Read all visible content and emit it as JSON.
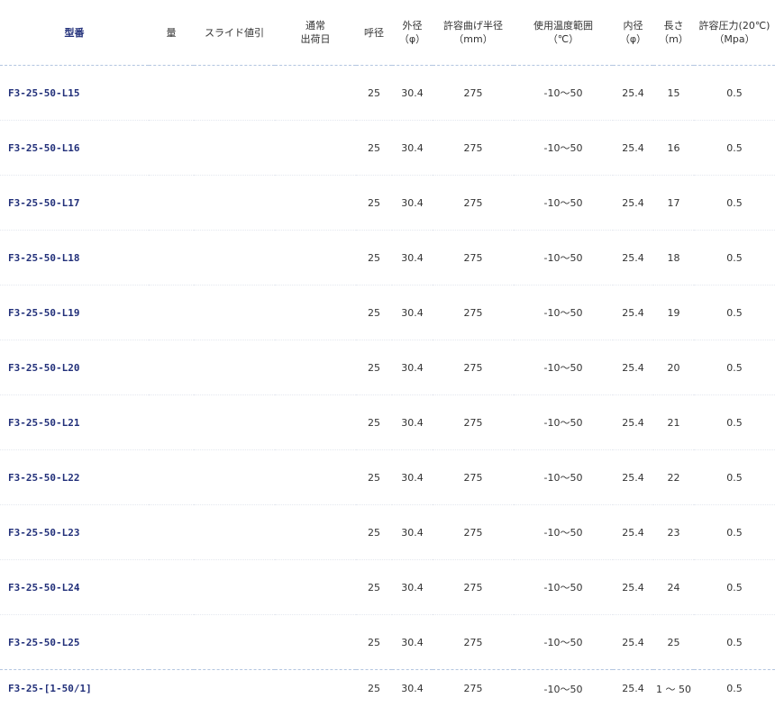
{
  "table": {
    "headers": {
      "model": "型番",
      "qty": "量",
      "discount": "スライド値引",
      "shipping_l1": "通常",
      "shipping_l2": "出荷日",
      "nominal": "呼径",
      "outer_l1": "外径",
      "outer_l2": "（φ）",
      "bend_l1": "許容曲げ半径",
      "bend_l2": "（mm）",
      "temp_l1": "使用温度範囲",
      "temp_l2": "（℃）",
      "inner_l1": "内径",
      "inner_l2": "（φ）",
      "length_l1": "長さ",
      "length_l2": "（m）",
      "pressure_l1": "許容圧力(20℃)",
      "pressure_l2": "（Mpa）"
    },
    "rows": [
      {
        "model": "F3-25-50-L15",
        "nominal": "25",
        "outer": "30.4",
        "bend": "275",
        "temp": "-10～50",
        "inner": "25.4",
        "length": "15",
        "pressure": "0.5"
      },
      {
        "model": "F3-25-50-L16",
        "nominal": "25",
        "outer": "30.4",
        "bend": "275",
        "temp": "-10～50",
        "inner": "25.4",
        "length": "16",
        "pressure": "0.5"
      },
      {
        "model": "F3-25-50-L17",
        "nominal": "25",
        "outer": "30.4",
        "bend": "275",
        "temp": "-10～50",
        "inner": "25.4",
        "length": "17",
        "pressure": "0.5"
      },
      {
        "model": "F3-25-50-L18",
        "nominal": "25",
        "outer": "30.4",
        "bend": "275",
        "temp": "-10～50",
        "inner": "25.4",
        "length": "18",
        "pressure": "0.5"
      },
      {
        "model": "F3-25-50-L19",
        "nominal": "25",
        "outer": "30.4",
        "bend": "275",
        "temp": "-10～50",
        "inner": "25.4",
        "length": "19",
        "pressure": "0.5"
      },
      {
        "model": "F3-25-50-L20",
        "nominal": "25",
        "outer": "30.4",
        "bend": "275",
        "temp": "-10～50",
        "inner": "25.4",
        "length": "20",
        "pressure": "0.5"
      },
      {
        "model": "F3-25-50-L21",
        "nominal": "25",
        "outer": "30.4",
        "bend": "275",
        "temp": "-10～50",
        "inner": "25.4",
        "length": "21",
        "pressure": "0.5"
      },
      {
        "model": "F3-25-50-L22",
        "nominal": "25",
        "outer": "30.4",
        "bend": "275",
        "temp": "-10～50",
        "inner": "25.4",
        "length": "22",
        "pressure": "0.5"
      },
      {
        "model": "F3-25-50-L23",
        "nominal": "25",
        "outer": "30.4",
        "bend": "275",
        "temp": "-10～50",
        "inner": "25.4",
        "length": "23",
        "pressure": "0.5"
      },
      {
        "model": "F3-25-50-L24",
        "nominal": "25",
        "outer": "30.4",
        "bend": "275",
        "temp": "-10～50",
        "inner": "25.4",
        "length": "24",
        "pressure": "0.5"
      },
      {
        "model": "F3-25-50-L25",
        "nominal": "25",
        "outer": "30.4",
        "bend": "275",
        "temp": "-10～50",
        "inner": "25.4",
        "length": "25",
        "pressure": "0.5"
      },
      {
        "model": "F3-25-[1-50/1]",
        "nominal": "25",
        "outer": "30.4",
        "bend": "275",
        "temp": "-10～50",
        "inner": "25.4",
        "length": "1 ～ 50",
        "pressure": "0.5"
      }
    ]
  }
}
